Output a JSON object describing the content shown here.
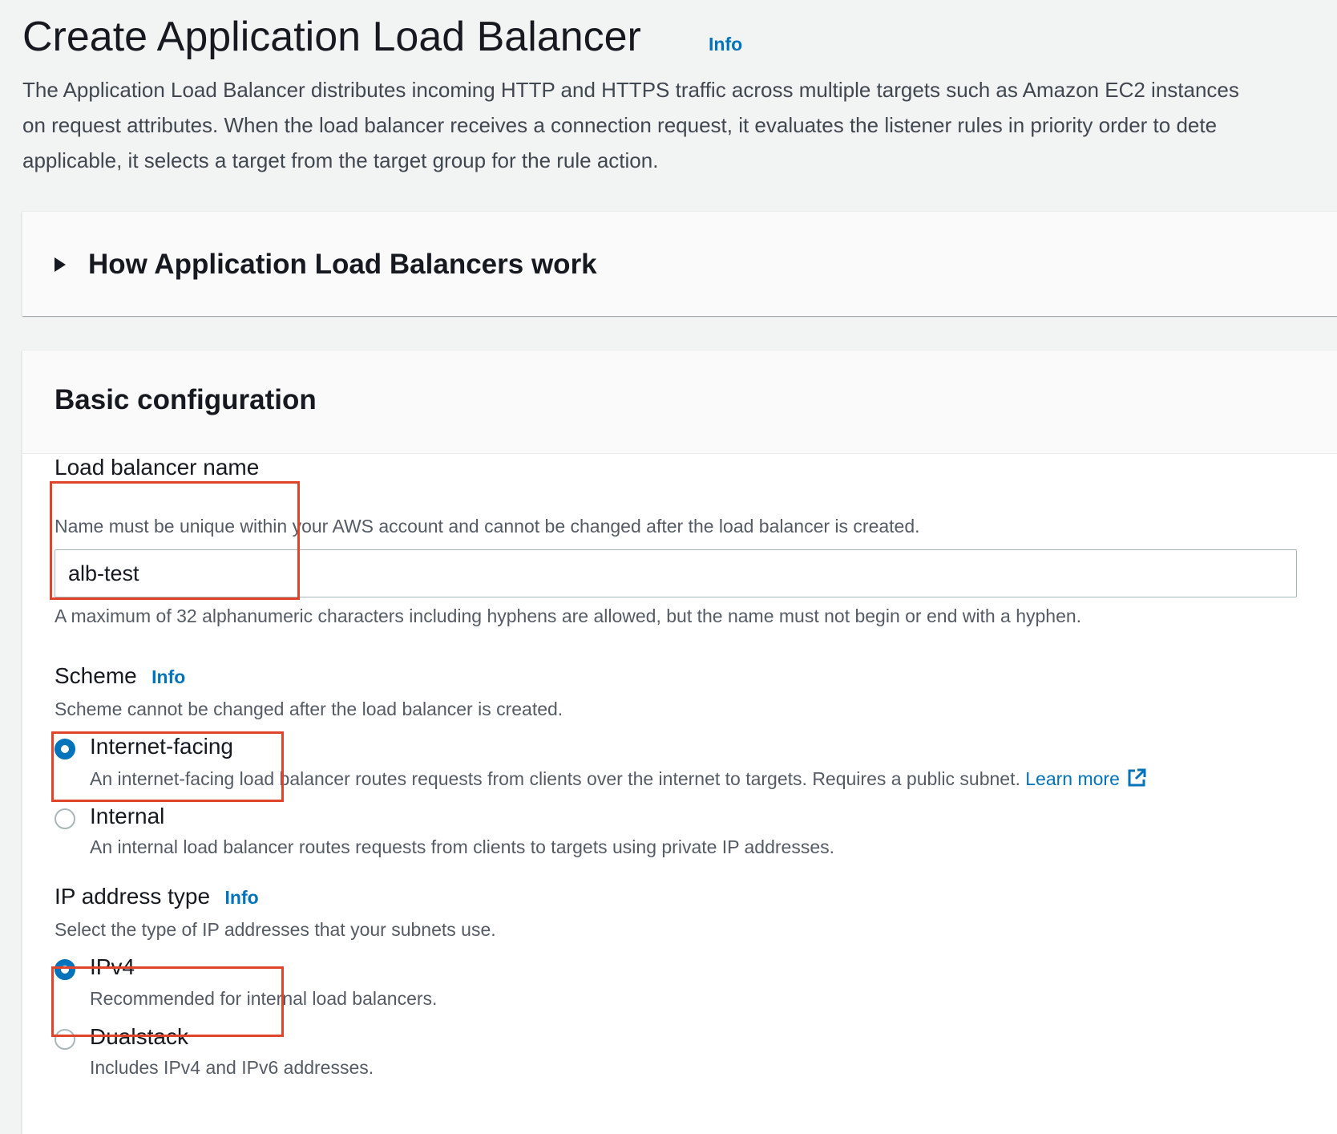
{
  "header": {
    "title": "Create Application Load Balancer",
    "info_link": "Info",
    "description_lines": [
      "The Application Load Balancer distributes incoming HTTP and HTTPS traffic across multiple targets such as Amazon EC2 instances",
      "on request attributes. When the load balancer receives a connection request, it evaluates the listener rules in priority order to dete",
      "applicable, it selects a target from the target group for the rule action."
    ]
  },
  "how_it_works": {
    "label": "How Application Load Balancers work"
  },
  "basic_config": {
    "title": "Basic configuration",
    "name_field": {
      "label": "Load balancer name",
      "description": "Name must be unique within your AWS account and cannot be changed after the load balancer is created.",
      "value": "alb-test",
      "constraint": "A maximum of 32 alphanumeric characters including hyphens are allowed, but the name must not begin or end with a hyphen."
    },
    "scheme": {
      "label": "Scheme",
      "info_link": "Info",
      "description": "Scheme cannot be changed after the load balancer is created.",
      "options": [
        {
          "label": "Internet-facing",
          "description": "An internet-facing load balancer routes requests from clients over the internet to targets. Requires a public subnet.",
          "link": "Learn more",
          "link_icon": "external-link-icon",
          "selected": true
        },
        {
          "label": "Internal",
          "description": "An internal load balancer routes requests from clients to targets using private IP addresses.",
          "selected": false
        }
      ]
    },
    "ip_address_type": {
      "label": "IP address type",
      "info_link": "Info",
      "description": "Select the type of IP addresses that your subnets use.",
      "options": [
        {
          "label": "IPv4",
          "description": "Recommended for internal load balancers.",
          "selected": true
        },
        {
          "label": "Dualstack",
          "description": "Includes IPv4 and IPv6 addresses.",
          "selected": false
        }
      ]
    }
  },
  "colors": {
    "link": "#0073bb",
    "radio_selected": "#0073bb",
    "annotation_box": "#e0442a",
    "page_background": "#f2f3f3"
  }
}
